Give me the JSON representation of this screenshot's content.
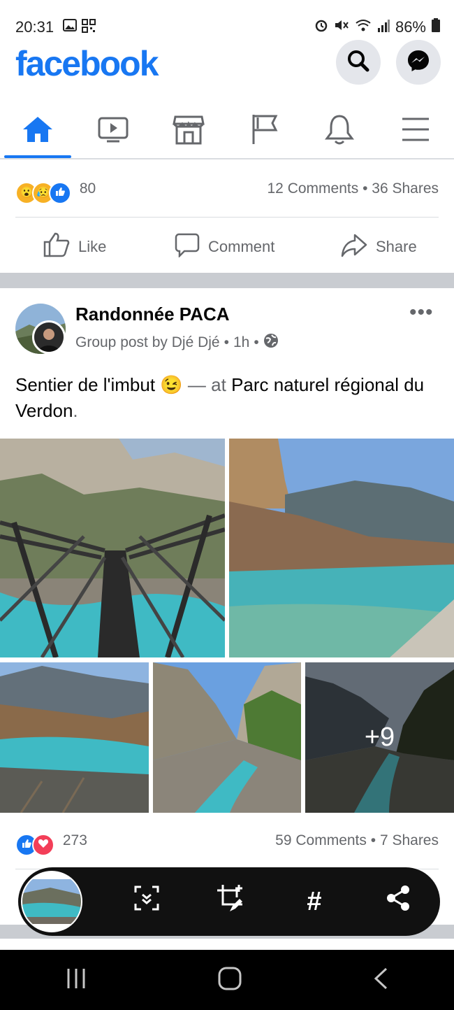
{
  "status_bar": {
    "time": "20:31",
    "battery": "86%"
  },
  "header": {
    "logo": "facebook",
    "search_icon": "search-icon",
    "messenger_icon": "messenger-icon"
  },
  "nav": {
    "items": [
      "home-icon",
      "video-icon",
      "marketplace-icon",
      "pages-flag-icon",
      "notifications-bell-icon",
      "menu-icon"
    ],
    "active": 0
  },
  "prev_post": {
    "reaction_count": "80",
    "comments": "12 Comments",
    "shares": "36 Shares",
    "sep": "•"
  },
  "actions": {
    "like": "Like",
    "comment": "Comment",
    "share": "Share"
  },
  "post": {
    "group": "Randonnée PACA",
    "meta_prefix": "Group post by Djé Djé",
    "time": "1h",
    "sep": "•",
    "text_main": "Sentier de l'imbut",
    "text_emoji": "😉",
    "text_dash": "— at",
    "text_place": "Parc naturel régional du Verdon",
    "text_end": ".",
    "more_photos": "+9",
    "reaction_count": "273",
    "comments": "59 Comments",
    "shares": "7 Shares"
  },
  "screenshot_toolbar": {
    "hashtag": "#"
  },
  "colors": {
    "brand": "#1877f2",
    "secondary_text": "#65676b",
    "band": "#c9ccd1"
  }
}
